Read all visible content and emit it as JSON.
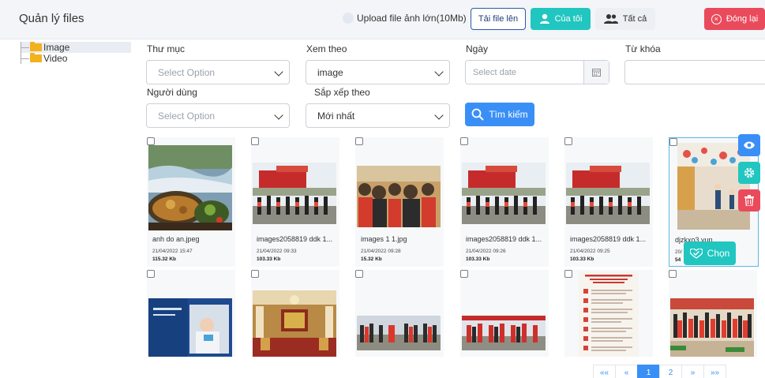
{
  "header": {
    "title": "Quản lý files",
    "upload_toggle_label": "Upload file ảnh lớn(10Mb)",
    "upload_button": "Tải file lên",
    "mine_button": "Của tôi",
    "all_button": "Tất cả",
    "close_button": "Đóng lại"
  },
  "tree": {
    "items": [
      {
        "label": "Image",
        "selected": true
      },
      {
        "label": "Video",
        "selected": false
      }
    ]
  },
  "filters": {
    "folder_label": "Thư mục",
    "folder_placeholder": "Select Option",
    "view_label": "Xem theo",
    "view_value": "image",
    "date_label": "Ngày",
    "date_placeholder": "Select date",
    "keyword_label": "Từ khóa",
    "user_label": "Người dùng",
    "user_placeholder": "Select Option",
    "sort_label": "Sắp xếp theo",
    "sort_value": "Mới nhất",
    "search_button": "Tìm kiếm"
  },
  "files": [
    {
      "name": "anh do an.jpeg",
      "date": "21/04/2022 15:47",
      "size": "115.32 Kb"
    },
    {
      "name": "images2058819 ddk 1...",
      "date": "21/04/2022 09:33",
      "size": "103.33 Kb"
    },
    {
      "name": "images 1 1.jpg",
      "date": "21/04/2022 09:28",
      "size": "15.32 Kb"
    },
    {
      "name": "images2058819 ddk 1...",
      "date": "21/04/2022 09:26",
      "size": "103.33 Kb"
    },
    {
      "name": "images2058819 ddk 1...",
      "date": "21/04/2022 09:25",
      "size": "103.33 Kb"
    },
    {
      "name": "djzkxo3 yup.jpg",
      "date": "20/",
      "size": "54"
    }
  ],
  "choose_button": "Chọn",
  "pagination": {
    "first": "««",
    "prev": "«",
    "page1": "1",
    "page2": "2",
    "next": "»",
    "last": "»»"
  },
  "colors": {
    "teal": "#21c6c0",
    "blue": "#3a8ff7",
    "red": "#ea4b5c"
  }
}
